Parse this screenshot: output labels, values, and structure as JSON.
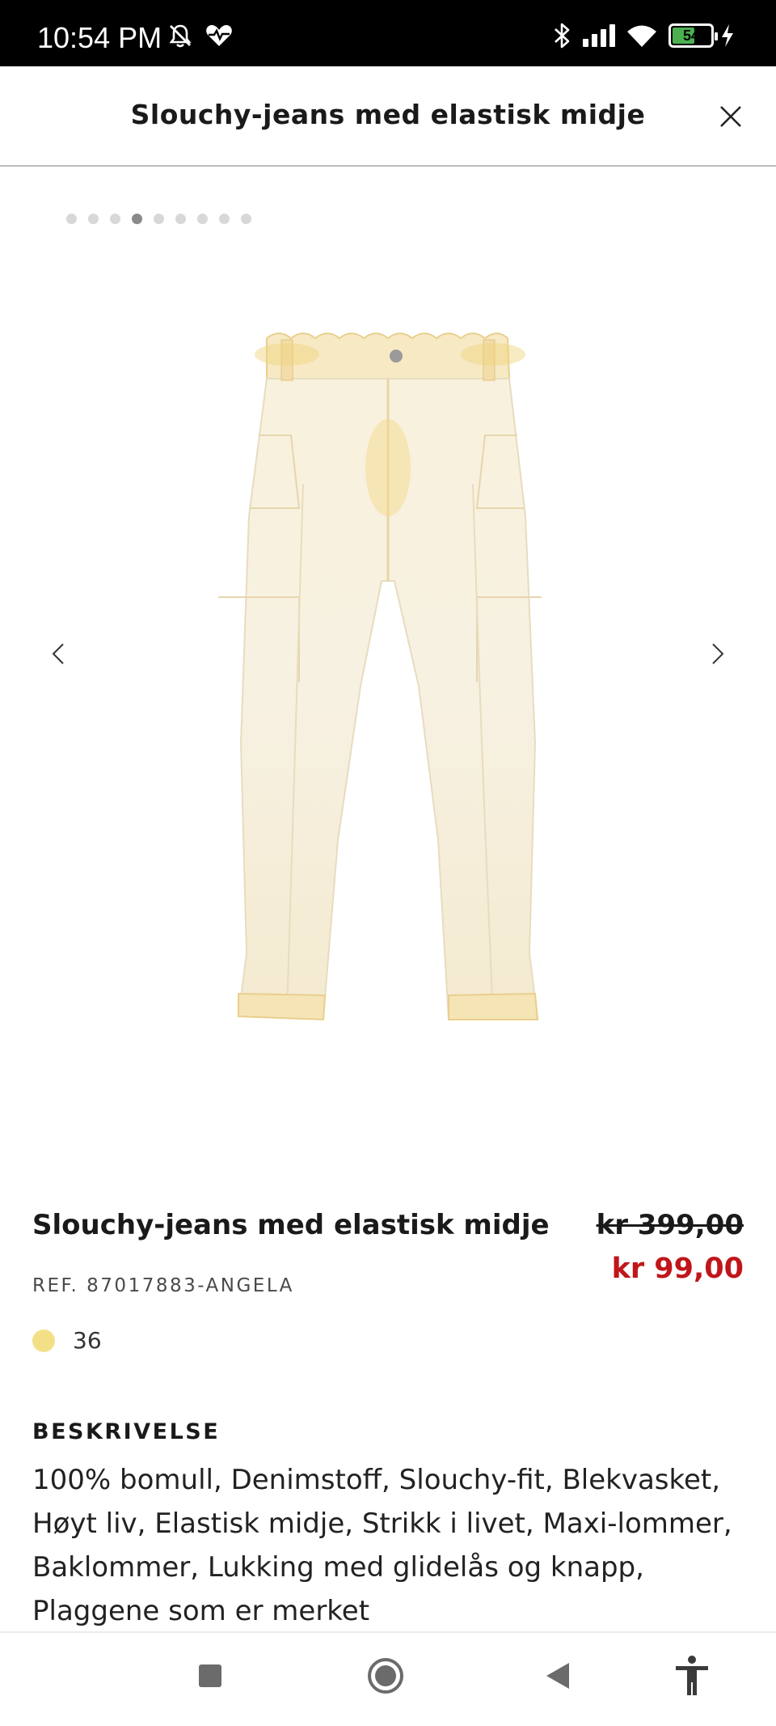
{
  "status_bar": {
    "time": "10:54 PM",
    "battery_level": "54",
    "icons": [
      "bell-muted-icon",
      "heart-pulse-icon",
      "bluetooth-icon",
      "signal-icon",
      "wifi-icon",
      "battery-icon",
      "charging-bolt-icon"
    ]
  },
  "header": {
    "title": "Slouchy-jeans med elastisk midje",
    "close_icon": "close-icon"
  },
  "carousel": {
    "total_images": 9,
    "active_index": 3,
    "prev_icon": "chevron-left-icon",
    "next_icon": "chevron-right-icon"
  },
  "product": {
    "title": "Slouchy-jeans med elastisk midje",
    "price_old": "kr 399,00",
    "price_new": "kr 99,00",
    "ref": "REF. 87017883-ANGELA",
    "color_hex": "#f3df86",
    "size": "36"
  },
  "description": {
    "heading": "BESKRIVELSE",
    "text": "100% bomull, Denimstoff, Slouchy-fit, Blekvasket, Høyt liv, Elastisk midje, Strikk i livet, Maxi-lommer, Baklommer, Lukking med glidelås og knapp, Plaggene som er merket"
  },
  "colors": {
    "sale_red": "#c0161b",
    "text_dark": "#1a1a1a"
  },
  "nav_bar": {
    "buttons": [
      "recent-apps-icon",
      "home-icon",
      "back-icon",
      "accessibility-icon"
    ]
  }
}
